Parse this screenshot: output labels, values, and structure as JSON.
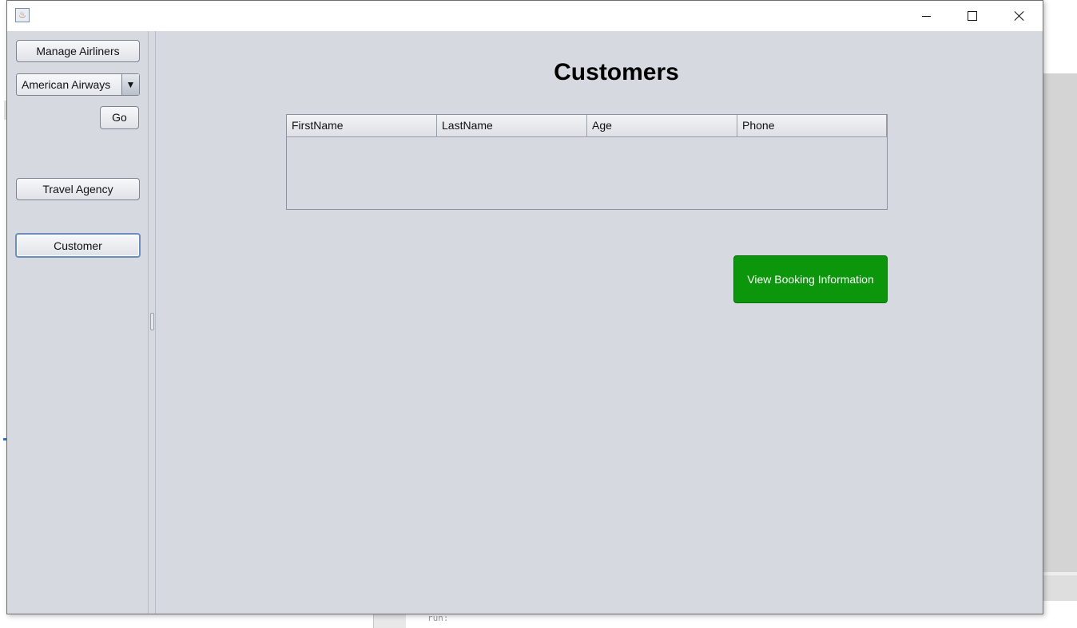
{
  "window": {
    "app_icon_glyph": "♨"
  },
  "sidebar": {
    "manage_airliners_label": "Manage Airliners",
    "airline_select": {
      "selected": "American Airways",
      "arrow": "▼"
    },
    "go_label": "Go",
    "travel_agency_label": "Travel Agency",
    "customer_label": "Customer"
  },
  "main": {
    "title": "Customers",
    "table": {
      "columns": [
        "FirstName",
        "LastName",
        "Age",
        "Phone"
      ],
      "rows": []
    },
    "view_booking_label": "View Booking Information"
  },
  "background": {
    "console_text": "run:"
  },
  "colors": {
    "panel_bg": "#d6d9e0",
    "accent_button": "#0c960c",
    "focus_border": "#6b8ebf"
  }
}
